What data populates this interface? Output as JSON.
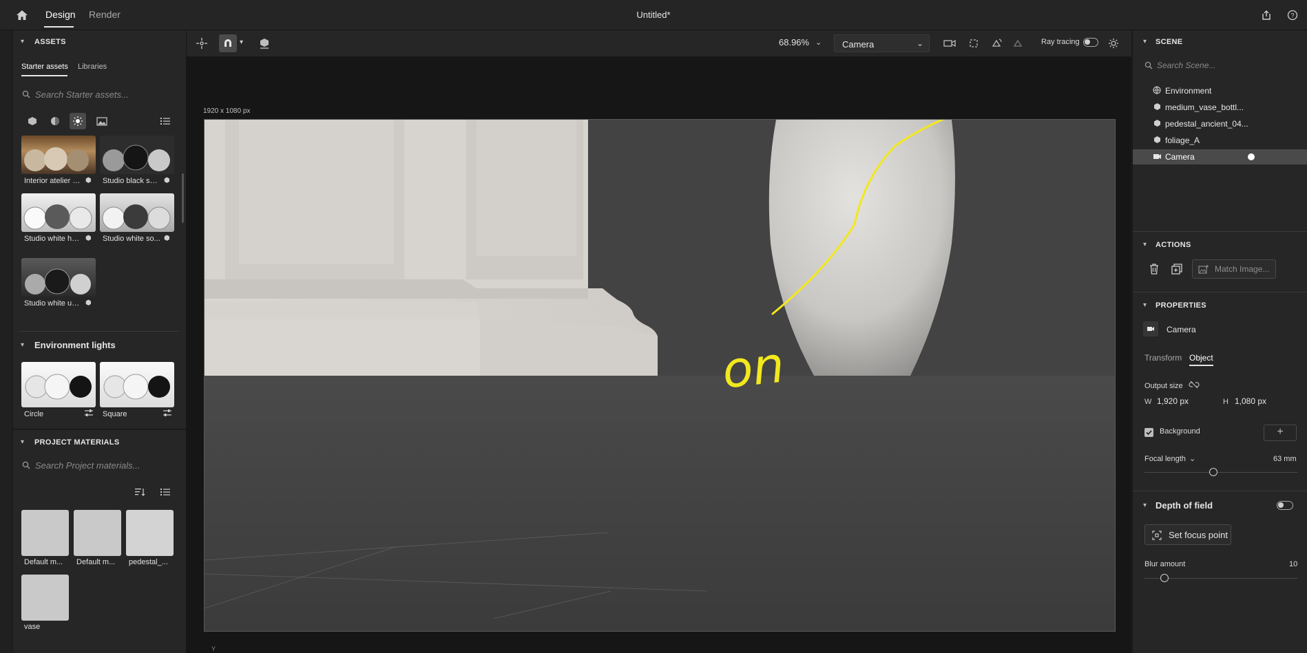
{
  "topbar": {
    "home_icon": "home-icon",
    "tabs": [
      {
        "label": "Design",
        "active": true
      },
      {
        "label": "Render",
        "active": false
      }
    ],
    "document_title": "Untitled*",
    "share_icon": "share-icon",
    "help_icon": "help-icon"
  },
  "assets": {
    "header": "ASSETS",
    "tabs": [
      {
        "label": "Starter assets",
        "active": true
      },
      {
        "label": "Libraries",
        "active": false
      }
    ],
    "search_placeholder": "Search Starter assets...",
    "filter_icons": [
      "models-icon",
      "materials-icon",
      "lights-icon",
      "images-icon"
    ],
    "list_view_icon": "list-view-icon",
    "lights": [
      {
        "label": "Interior atelier s...",
        "badge_icon": "cube-badge-icon"
      },
      {
        "label": "Studio black soft...",
        "badge_icon": "cube-badge-icon"
      },
      {
        "label": "Studio white ha...",
        "badge_icon": "cube-badge-icon"
      },
      {
        "label": "Studio white so...",
        "badge_icon": "cube-badge-icon"
      },
      {
        "label": "Studio white um...",
        "badge_icon": "cube-badge-icon"
      }
    ],
    "env_lights_header": "Environment lights",
    "env_lights": [
      {
        "label": "Circle",
        "badge_icon": "sliders-icon"
      },
      {
        "label": "Square",
        "badge_icon": "sliders-icon"
      }
    ]
  },
  "project_materials": {
    "header": "PROJECT MATERIALS",
    "search_placeholder": "Search Project materials...",
    "sort_icon": "sort-icon",
    "list_view_icon": "list-view-icon",
    "items": [
      {
        "label": "Default m..."
      },
      {
        "label": "Default m..."
      },
      {
        "label": "pedestal_..."
      },
      {
        "label": "vase"
      }
    ]
  },
  "toolbar": {
    "zoom": "68.96%",
    "camera_select": "Camera",
    "ray_tracing_label": "Ray tracing",
    "ray_tracing_on": false
  },
  "viewport": {
    "canvas_size_label": "1920 x 1080 px",
    "axis_label": "Y",
    "annotation_text": "on"
  },
  "scene": {
    "header": "SCENE",
    "search_placeholder": "Search Scene...",
    "items": [
      {
        "label": "Environment",
        "icon": "globe-icon",
        "selected": false
      },
      {
        "label": "medium_vase_bottl...",
        "icon": "object-icon",
        "selected": false
      },
      {
        "label": "pedestal_ancient_04...",
        "icon": "object-icon",
        "selected": false
      },
      {
        "label": "foliage_A",
        "icon": "object-icon",
        "selected": false
      },
      {
        "label": "Camera",
        "icon": "camera-icon",
        "selected": true
      }
    ]
  },
  "actions": {
    "header": "ACTIONS",
    "match_image_label": "Match Image..."
  },
  "properties": {
    "header": "PROPERTIES",
    "object_name": "Camera",
    "tabs": [
      {
        "label": "Transform",
        "active": false
      },
      {
        "label": "Object",
        "active": true
      }
    ],
    "output_size_label": "Output size",
    "width_label": "W",
    "width_value": "1,920 px",
    "height_label": "H",
    "height_value": "1,080 px",
    "background_label": "Background",
    "background_checked": true,
    "focal_length_label": "Focal length",
    "focal_length_value": "63 mm",
    "focal_length_fraction": 0.45,
    "depth_of_field_label": "Depth of field",
    "set_focus_point_label": "Set focus point",
    "blur_amount_label": "Blur amount",
    "blur_amount_value": "10",
    "blur_amount_fraction": 0.13
  }
}
